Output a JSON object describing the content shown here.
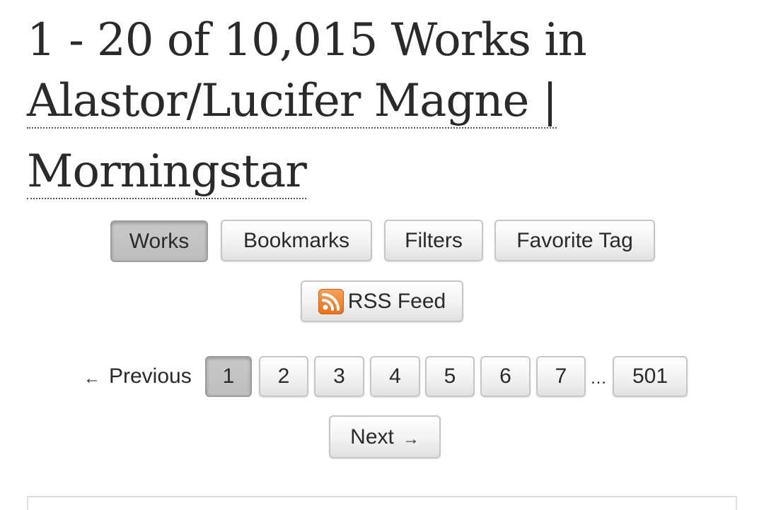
{
  "heading": {
    "count_text": "1 - 20 of 10,015 Works in",
    "tag_line_1": "Alastor/Lucifer Magne | ",
    "tag_line_2": "Morningstar"
  },
  "nav": {
    "works": "Works",
    "bookmarks": "Bookmarks",
    "filters": "Filters",
    "favorite_tag": "Favorite Tag",
    "rss_feed": "RSS Feed"
  },
  "pagination": {
    "previous_arrow": "←",
    "previous": "Previous",
    "pages": [
      "1",
      "2",
      "3",
      "4",
      "5",
      "6",
      "7"
    ],
    "gap": "…",
    "last_page": "501",
    "current_page": "1",
    "next": "Next",
    "next_arrow": "→"
  },
  "icons": {
    "rss": "rss-icon"
  },
  "colors": {
    "rss_orange": "#e8711a",
    "current_button": "#bdbdbd",
    "text": "#2a2a2a"
  }
}
